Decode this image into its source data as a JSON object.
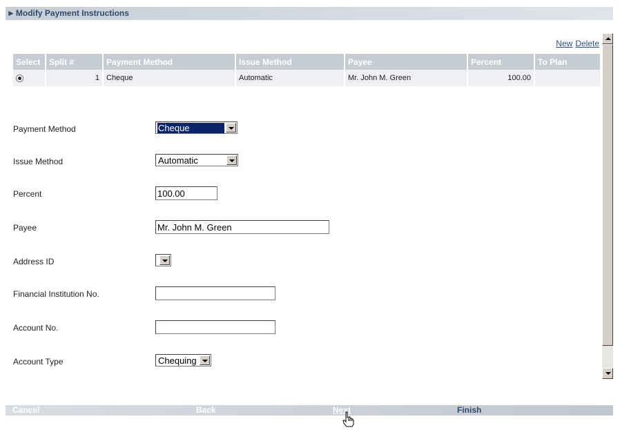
{
  "header": {
    "title": "Modify Payment Instructions"
  },
  "links": {
    "new": "New",
    "delete": "Delete"
  },
  "table": {
    "columns": [
      "Select",
      "Split #",
      "Payment Method",
      "Issue Method",
      "Payee",
      "Percent",
      "To Plan"
    ],
    "rows": [
      {
        "split": "1",
        "payment_method": "Cheque",
        "issue_method": "Automatic",
        "payee": "Mr. John M. Green",
        "percent": "100.00",
        "to_plan": ""
      }
    ]
  },
  "form": {
    "payment_method": {
      "label": "Payment Method",
      "value": "Cheque"
    },
    "issue_method": {
      "label": "Issue Method",
      "value": "Automatic"
    },
    "percent": {
      "label": "Percent",
      "value": "100.00"
    },
    "payee": {
      "label": "Payee",
      "value": "Mr. John M. Green"
    },
    "address_id": {
      "label": "Address ID",
      "value": ""
    },
    "financial_institution": {
      "label": "Financial Institution No.",
      "value": ""
    },
    "account_no": {
      "label": "Account No.",
      "value": ""
    },
    "account_type": {
      "label": "Account Type",
      "value": "Chequing"
    }
  },
  "footer": {
    "cancel": "Cancel",
    "back": "Back",
    "next": "Next",
    "finish": "Finish"
  }
}
